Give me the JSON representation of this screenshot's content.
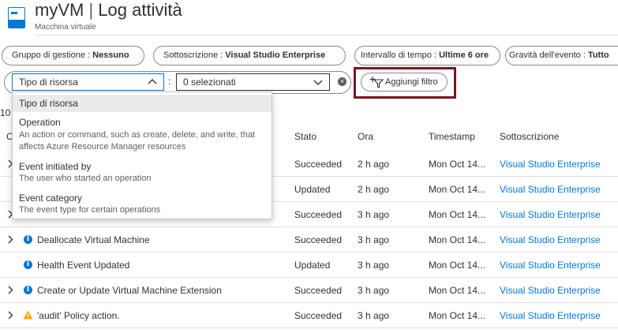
{
  "header": {
    "title_name": "myVM",
    "title_separator": "|",
    "title_page": "Log attività",
    "subtitle": "Macchina virtuale"
  },
  "filters": {
    "pills": [
      {
        "label": "Gruppo di gestione : ",
        "value": "Nessuno"
      },
      {
        "label": "Sottoscrizione : ",
        "value": "Visual Studio Enterprise"
      },
      {
        "label": "Intervallo di tempo : ",
        "value": "Ultime 6 ore"
      },
      {
        "label": "Gravità dell'evento : ",
        "value": "Tutto"
      }
    ],
    "resource_type_dropdown": "Tipo di risorsa",
    "colon": ":",
    "selection_dropdown": "0 selezionati",
    "add_filter_label": "Aggiungi filtro"
  },
  "popup": {
    "selected": "Tipo di risorsa",
    "options": [
      {
        "title": "Operation",
        "desc": "An action or command, such as create, delete, and write, that affects Azure Resource Manager resources"
      },
      {
        "title": "Event initiated by",
        "desc": "The user who started an operation"
      },
      {
        "title": "Event category",
        "desc": "The event type for certain operations"
      }
    ]
  },
  "table": {
    "count_text": "10",
    "col_partial": "C",
    "headers": {
      "stato": "Stato",
      "ora": "Ora",
      "timestamp": "Timestamp",
      "sottoscrizione": "Sottoscrizione"
    },
    "rows": [
      {
        "name": "",
        "stato": "Succeeded",
        "ora": "2 h ago",
        "timestamp": "Mon Oct 14...",
        "sub": "Visual Studio Enterprise",
        "icon": "none",
        "expand": true
      },
      {
        "name": "",
        "stato": "Updated",
        "ora": "2 h ago",
        "timestamp": "Mon Oct 14...",
        "sub": "Visual Studio Enterprise",
        "icon": "none",
        "expand": false
      },
      {
        "name": "",
        "stato": "Succeeded",
        "ora": "3 h ago",
        "timestamp": "Mon Oct 14...",
        "sub": "Visual Studio Enterprise",
        "icon": "none",
        "expand": true
      },
      {
        "name": "Deallocate Virtual Machine",
        "stato": "Succeeded",
        "ora": "3 h ago",
        "timestamp": "Mon Oct 14...",
        "sub": "Visual Studio Enterprise",
        "icon": "info",
        "expand": true
      },
      {
        "name": "Health Event Updated",
        "stato": "Updated",
        "ora": "3 h ago",
        "timestamp": "Mon Oct 14...",
        "sub": "Visual Studio Enterprise",
        "icon": "info",
        "expand": false
      },
      {
        "name": "Create or Update Virtual Machine Extension",
        "stato": "Succeeded",
        "ora": "3 h ago",
        "timestamp": "Mon Oct 14...",
        "sub": "Visual Studio Enterprise",
        "icon": "info",
        "expand": true
      },
      {
        "name": "'audit' Policy action.",
        "stato": "Succeeded",
        "ora": "3 h ago",
        "timestamp": "Mon Oct 14...",
        "sub": "Visual Studio Enterprise",
        "icon": "warning",
        "expand": true
      }
    ]
  },
  "colors": {
    "accent": "#0078d4",
    "highlight_border": "#7b1520",
    "warning": "#f7a600"
  }
}
